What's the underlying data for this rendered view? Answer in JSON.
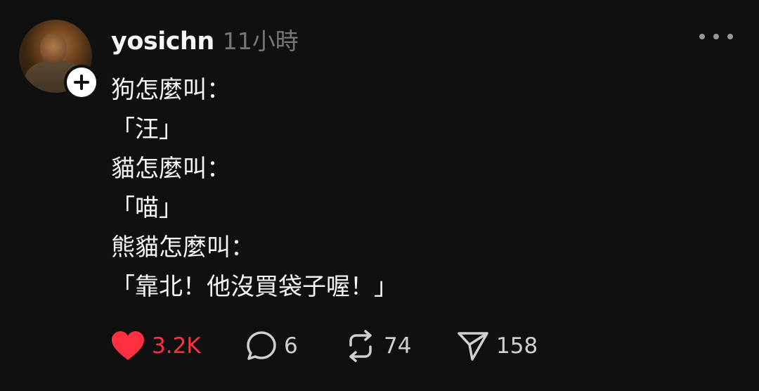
{
  "post": {
    "username": "yosichn",
    "timestamp": "11小時",
    "lines": [
      "狗怎麼叫：",
      "「汪」",
      "貓怎麼叫：",
      "「喵」",
      "熊貓怎麼叫：",
      "「靠北！他沒買袋子喔！」"
    ]
  },
  "actions": {
    "likes": "3.2K",
    "replies": "6",
    "reposts": "74",
    "shares": "158"
  },
  "colors": {
    "background": "#101010",
    "text": "#f3f5f7",
    "muted": "#777777",
    "like": "#ff3040"
  }
}
